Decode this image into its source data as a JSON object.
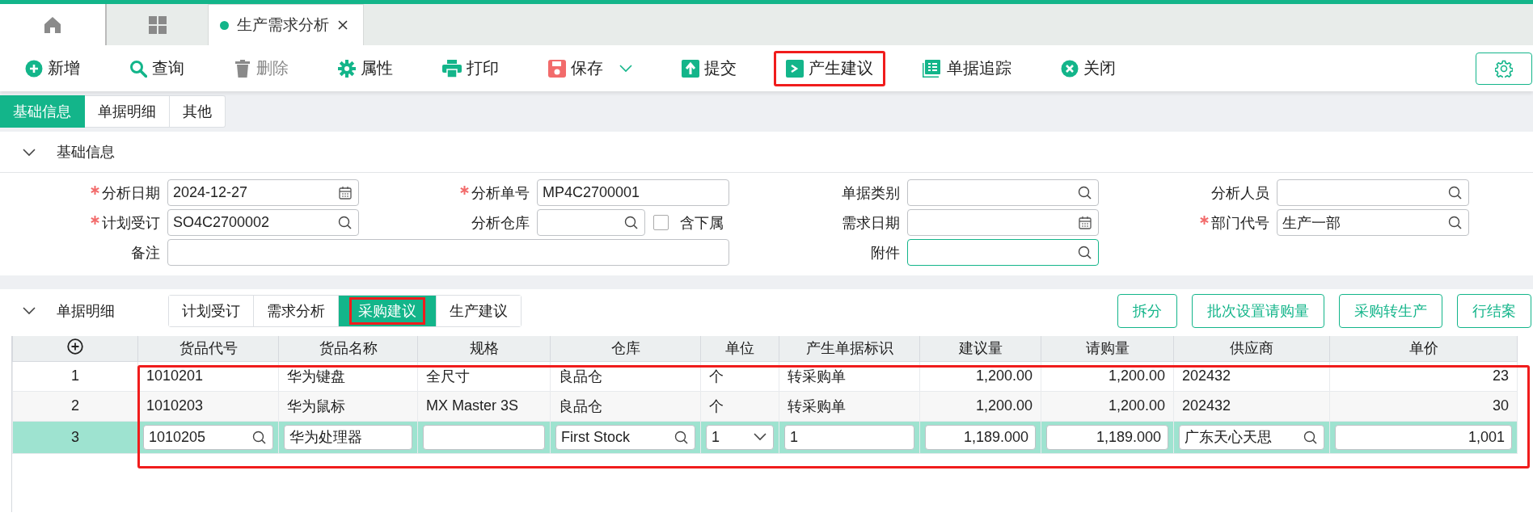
{
  "app_tabs": [
    {
      "kind": "home"
    },
    {
      "kind": "apps",
      "selected": false
    },
    {
      "kind": "document",
      "label": "生产需求分析",
      "selected": true
    }
  ],
  "toolbar": {
    "buttons": [
      {
        "kind": "new",
        "label": "新增",
        "disabled": false,
        "highlighted": false
      },
      {
        "kind": "query",
        "label": "查询",
        "disabled": false,
        "highlighted": false
      },
      {
        "kind": "delete",
        "label": "删除",
        "disabled": true,
        "highlighted": false
      },
      {
        "kind": "properties",
        "label": "属性",
        "disabled": false,
        "highlighted": false
      },
      {
        "kind": "print",
        "label": "打印",
        "disabled": false,
        "highlighted": false
      },
      {
        "kind": "save",
        "label": "保存",
        "disabled": false,
        "highlighted": false,
        "dropdown": true
      },
      {
        "kind": "submit",
        "label": "提交",
        "disabled": false,
        "highlighted": false
      },
      {
        "kind": "generate",
        "label": "产生建议",
        "disabled": false,
        "highlighted": true
      },
      {
        "kind": "trace",
        "label": "单据追踪",
        "disabled": false,
        "highlighted": false
      },
      {
        "kind": "close",
        "label": "关闭",
        "disabled": false,
        "highlighted": false
      }
    ]
  },
  "form_tabs": [
    {
      "label": "基础信息",
      "selected": true
    },
    {
      "label": "单据明细",
      "selected": false
    },
    {
      "label": "其他",
      "selected": false
    }
  ],
  "basic_info": {
    "title": "基础信息",
    "expanded": true,
    "rows": [
      [
        {
          "label": "分析日期",
          "required": true,
          "kind": "date",
          "value": "2024-12-27",
          "focused": false
        },
        {
          "label": "分析单号",
          "required": true,
          "kind": "text",
          "value": "MP4C2700001",
          "focused": false
        },
        {
          "label": "单据类别",
          "required": false,
          "kind": "lookup",
          "focused": false
        },
        {
          "label": "分析人员",
          "required": false,
          "kind": "lookup",
          "focused": false
        }
      ],
      [
        {
          "label": "计划受订",
          "required": true,
          "kind": "lookup",
          "value": "SO4C2700002",
          "focused": false
        },
        {
          "label": "分析仓库",
          "required": false,
          "kind": "lookup",
          "focused": false,
          "checkbox": {
            "label": "含下属",
            "checked": false
          }
        },
        {
          "label": "需求日期",
          "required": false,
          "kind": "date",
          "focused": false
        },
        {
          "label": "部门代号",
          "required": true,
          "kind": "lookup",
          "value": "生产一部",
          "focused": false
        }
      ],
      [
        {
          "label": "备注",
          "required": false,
          "kind": "wide",
          "focused": false
        },
        "",
        {
          "label": "附件",
          "required": false,
          "kind": "lookup",
          "focused": true
        }
      ]
    ]
  },
  "detail": {
    "title": "单据明细",
    "expanded": true,
    "tabs": [
      {
        "label": "计划受订",
        "selected": false,
        "highlighted": false
      },
      {
        "label": "需求分析",
        "selected": false,
        "highlighted": false
      },
      {
        "label": "采购建议",
        "selected": true,
        "highlighted": true
      },
      {
        "label": "生产建议",
        "selected": false,
        "highlighted": false
      }
    ],
    "actions": [
      "拆分",
      "批次设置请购量",
      "采购转生产",
      "行结案"
    ],
    "table": {
      "highlighted": true,
      "columns": [
        {
          "label": "货品代号",
          "kind": "lookup"
        },
        {
          "label": "货品名称",
          "kind": "text"
        },
        {
          "label": "规格",
          "kind": "text"
        },
        {
          "label": "仓库",
          "kind": "lookup"
        },
        {
          "label": "单位",
          "kind": "select"
        },
        {
          "label": "产生单据标识",
          "kind": "text"
        },
        {
          "label": "建议量",
          "kind": "number"
        },
        {
          "label": "请购量",
          "kind": "number"
        },
        {
          "label": "供应商",
          "kind": "lookup"
        },
        {
          "label": "单价",
          "kind": "number"
        }
      ],
      "rows": [
        {
          "index": "1",
          "selected": false,
          "editing": false,
          "cells": [
            "1010201",
            "华为键盘",
            "全尺寸",
            "良品仓",
            "个",
            "转采购单",
            "1,200.00",
            "1,200.00",
            "202432",
            "23"
          ]
        },
        {
          "index": "2",
          "selected": false,
          "editing": false,
          "cells": [
            "1010203",
            "华为鼠标",
            "MX Master 3S",
            "良品仓",
            "个",
            "转采购单",
            "1,200.00",
            "1,200.00",
            "202432",
            "30"
          ]
        },
        {
          "index": "3",
          "selected": true,
          "editing": true,
          "cells": [
            "1010205",
            "华为处理器",
            null,
            "First Stock",
            "1",
            "1",
            "1,189.000",
            "1,189.000",
            "广东天心天思",
            "1,001"
          ]
        }
      ]
    }
  }
}
